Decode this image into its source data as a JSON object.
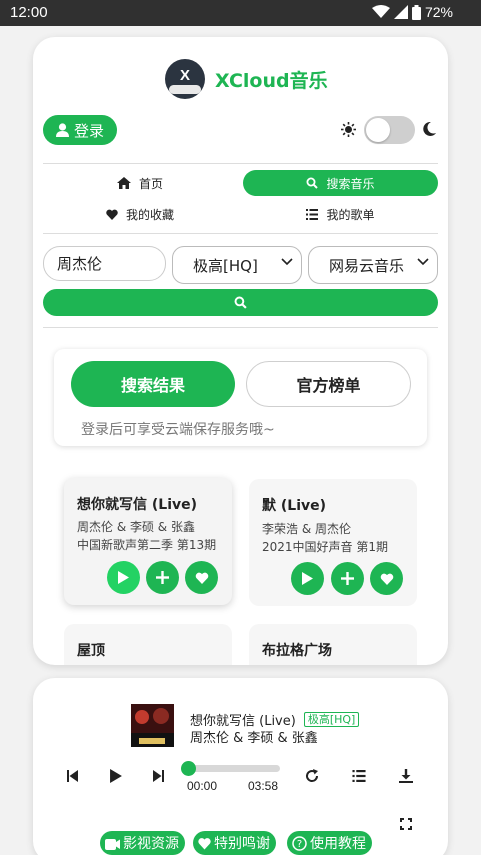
{
  "status_bar": {
    "time": "12:00",
    "battery": "72%"
  },
  "app": {
    "name": "XCloud音乐",
    "logo_letter": "X"
  },
  "header": {
    "login_label": "登录"
  },
  "nav": {
    "home": "首页",
    "search_music": "搜索音乐",
    "favorites": "我的收藏",
    "playlists": "我的歌单"
  },
  "search": {
    "query": "周杰伦",
    "quality": "极高[HQ]",
    "source": "网易云音乐"
  },
  "tabs": {
    "results": "搜索结果",
    "charts": "官方榜单",
    "login_hint": "登录后可享受云端保存服务哦~"
  },
  "songs": [
    {
      "title": "想你就写信 (Live)",
      "artist": "周杰伦 & 李硕 & 张鑫",
      "album": "中国新歌声第二季 第13期"
    },
    {
      "title": "默 (Live)",
      "artist": "李荣浩 & 周杰伦",
      "album": "2021中国好声音 第1期"
    },
    {
      "title": "屋顶",
      "artist": "",
      "album": ""
    },
    {
      "title": "布拉格广场",
      "artist": "",
      "album": ""
    }
  ],
  "now_playing": {
    "title": "想你就写信 (Live)",
    "quality_badge": "极高[HQ]",
    "artist": "周杰伦 & 李硕 & 张鑫",
    "current_time": "00:00",
    "duration": "03:58",
    "progress": 0
  },
  "footer": {
    "video": "影视资源",
    "thanks": "特别鸣谢",
    "tutorial": "使用教程"
  },
  "colors": {
    "accent": "#1eb553",
    "status_bar": "#303030",
    "background": "#f2f2f2"
  }
}
